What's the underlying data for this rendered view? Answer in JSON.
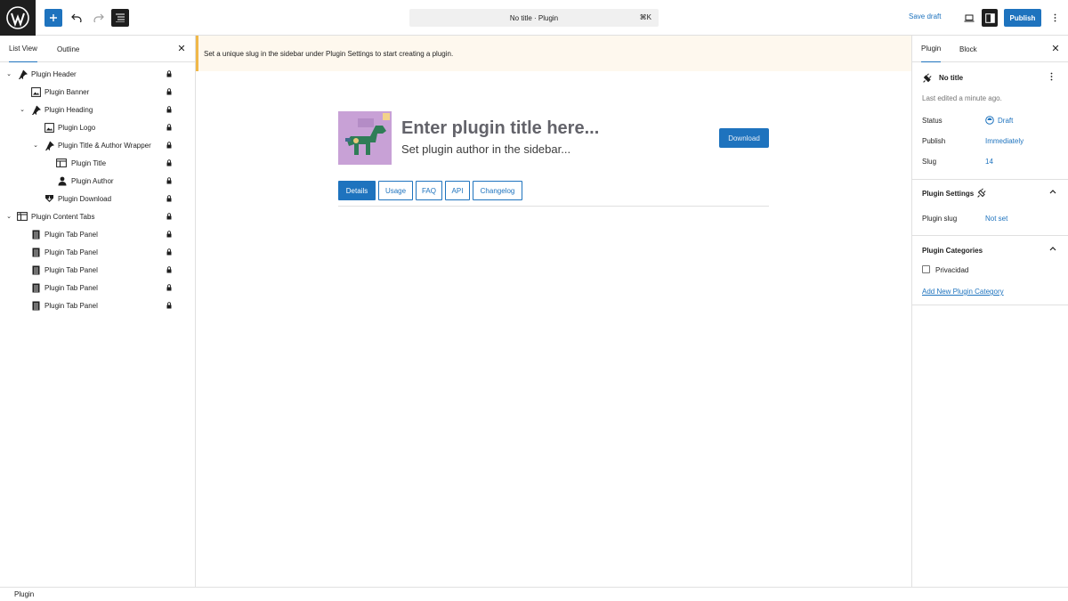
{
  "topbar": {
    "command_label": "No title · Plugin",
    "command_shortcut": "⌘K",
    "save_draft": "Save draft",
    "publish": "Publish"
  },
  "left_panel": {
    "tabs": [
      "List View",
      "Outline"
    ],
    "tree": [
      {
        "label": "Plugin Header",
        "icon": "pin-icon",
        "expanded": true
      },
      {
        "label": "Plugin Banner",
        "icon": "image-icon"
      },
      {
        "label": "Plugin Heading",
        "icon": "pin-icon",
        "expanded": true
      },
      {
        "label": "Plugin Logo",
        "icon": "image-icon"
      },
      {
        "label": "Plugin Title & Author Wrapper",
        "icon": "pin-icon",
        "expanded": true
      },
      {
        "label": "Plugin Title",
        "icon": "title-icon"
      },
      {
        "label": "Plugin Author",
        "icon": "person-icon"
      },
      {
        "label": "Plugin Download",
        "icon": "download-icon"
      },
      {
        "label": "Plugin Content Tabs",
        "icon": "tabs-icon",
        "expanded": true
      },
      {
        "label": "Plugin Tab Panel",
        "icon": "document-icon"
      },
      {
        "label": "Plugin Tab Panel",
        "icon": "document-icon"
      },
      {
        "label": "Plugin Tab Panel",
        "icon": "document-icon"
      },
      {
        "label": "Plugin Tab Panel",
        "icon": "document-icon"
      },
      {
        "label": "Plugin Tab Panel",
        "icon": "document-icon"
      }
    ]
  },
  "canvas": {
    "notice": "Set a unique slug in the sidebar under Plugin Settings to start creating a plugin.",
    "title_placeholder": "Enter plugin title here...",
    "author_placeholder": "Set plugin author in the sidebar...",
    "download_label": "Download",
    "tabs": [
      "Details",
      "Usage",
      "FAQ",
      "API",
      "Changelog"
    ],
    "active_tab": "Details"
  },
  "right_panel": {
    "tabs": [
      "Plugin",
      "Block"
    ],
    "summary": {
      "title": "No title",
      "last_edited": "Last edited a minute ago.",
      "status_label": "Status",
      "status_value": "Draft",
      "publish_label": "Publish",
      "publish_value": "Immediately",
      "slug_label": "Slug",
      "slug_value": "14"
    },
    "settings": {
      "heading": "Plugin Settings",
      "slug_label": "Plugin slug",
      "slug_value": "Not set"
    },
    "categories": {
      "heading": "Plugin Categories",
      "items": [
        "Privacidad"
      ],
      "add_link": "Add New Plugin Category"
    }
  },
  "footer": {
    "breadcrumb": "Plugin"
  },
  "colors": {
    "accent": "#1e73be",
    "notice_bg": "#fef8ee",
    "notice_border": "#f0b849",
    "dark": "#1e1e1e",
    "banner_bg": "#c8a1d6",
    "horse_green": "#2f7d57"
  }
}
